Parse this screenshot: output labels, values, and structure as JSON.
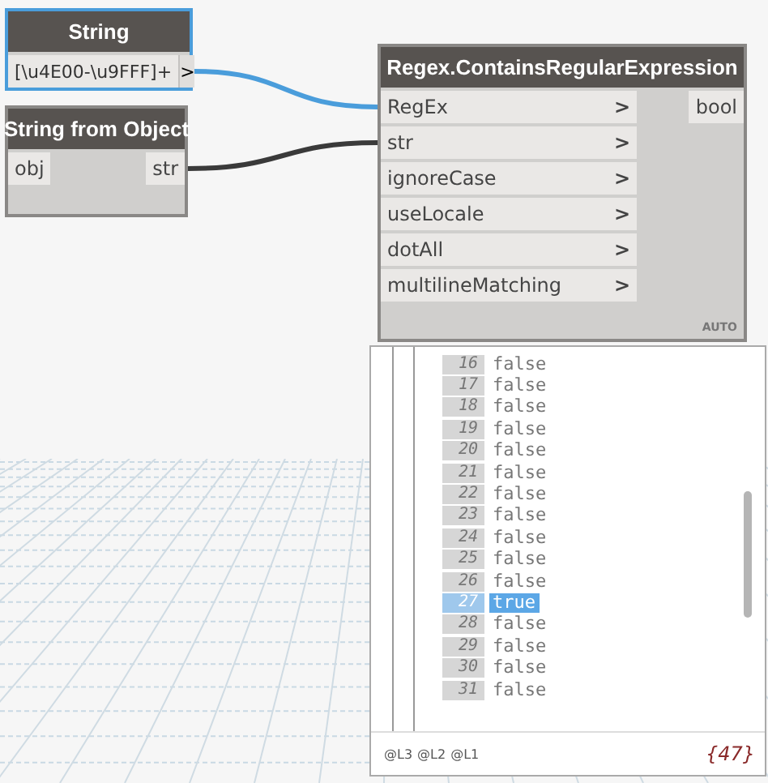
{
  "nodes": [
    {
      "kind": "input",
      "title": "String",
      "selected": true,
      "value": "[\\u4E00-\\u9FFF]+",
      "output": ">"
    },
    {
      "kind": "function",
      "title": "String from Object",
      "selected": false,
      "inputs": [
        {
          "name": "obj"
        }
      ],
      "outputs": [
        "str"
      ]
    },
    {
      "kind": "function",
      "title": "Regex.ContainsRegularExpression",
      "selected": false,
      "inputs": [
        {
          "name": "RegEx",
          "arrow": ">"
        },
        {
          "name": "str",
          "arrow": ">"
        },
        {
          "name": "ignoreCase",
          "arrow": ">"
        },
        {
          "name": "useLocale",
          "arrow": ">"
        },
        {
          "name": "dotAll",
          "arrow": ">"
        },
        {
          "name": "multilineMatching",
          "arrow": ">"
        }
      ],
      "outputs": [
        "bool"
      ],
      "lacing": "AUTO"
    }
  ],
  "watch": {
    "items": [
      {
        "index": "16",
        "value": "false",
        "selected": false
      },
      {
        "index": "17",
        "value": "false",
        "selected": false
      },
      {
        "index": "18",
        "value": "false",
        "selected": false
      },
      {
        "index": "19",
        "value": "false",
        "selected": false
      },
      {
        "index": "20",
        "value": "false",
        "selected": false
      },
      {
        "index": "21",
        "value": "false",
        "selected": false
      },
      {
        "index": "22",
        "value": "false",
        "selected": false
      },
      {
        "index": "23",
        "value": "false",
        "selected": false
      },
      {
        "index": "24",
        "value": "false",
        "selected": false
      },
      {
        "index": "25",
        "value": "false",
        "selected": false
      },
      {
        "index": "26",
        "value": "false",
        "selected": false
      },
      {
        "index": "27",
        "value": "true",
        "selected": true
      },
      {
        "index": "28",
        "value": "false",
        "selected": false
      },
      {
        "index": "29",
        "value": "false",
        "selected": false
      },
      {
        "index": "30",
        "value": "false",
        "selected": false
      },
      {
        "index": "31",
        "value": "false",
        "selected": false
      }
    ],
    "levels": [
      "@L3",
      "@L2",
      "@L1"
    ],
    "count": "{47}"
  }
}
